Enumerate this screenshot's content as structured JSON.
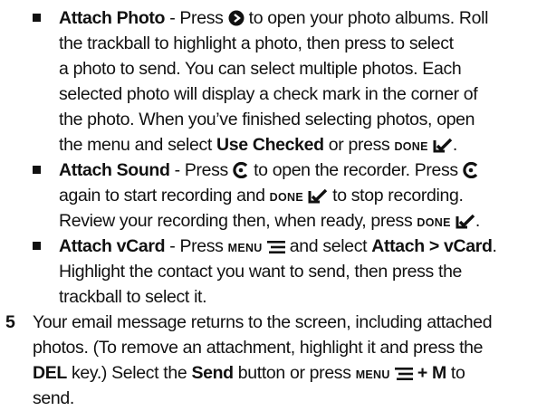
{
  "items": {
    "photo": {
      "title": "Attach Photo",
      "l1a": " - Press ",
      "l1b": " to open your photo albums. Roll",
      "l2": "the trackball to highlight a photo, then press to select",
      "l3": "a photo to send. You can select multiple photos. Each",
      "l4": "selected photo will display a check mark in the corner of",
      "l5": "the photo. When you’ve finished selecting photos, open",
      "l6a": "the menu and select ",
      "l6b": "Use Checked",
      "l6c": " or press ",
      "l6d": "DONE",
      "l6e": "."
    },
    "sound": {
      "title": "Attach Sound",
      "l1a": " - Press ",
      "l1b": " to open the recorder. Press ",
      "l2a": "again to start recording and ",
      "l2b": "DONE",
      "l2c": " to stop recording.",
      "l3a": "Review your recording then, when ready, press ",
      "l3b": "DONE",
      "l3c": "."
    },
    "vcard": {
      "title": "Attach vCard",
      "l1a": " - Press ",
      "l1b": "MENU",
      "l1c": " and select ",
      "l1d": "Attach > vCard",
      "l1e": ".",
      "l2": "Highlight the contact you want to send, then press the",
      "l3": "trackball to select it."
    }
  },
  "step5": {
    "number": "5",
    "l1": "Your email message returns to the screen, including attached",
    "l2": "photos. (To remove an attachment, highlight it and press the",
    "l3a": "DEL",
    "l3b": " key.) Select the ",
    "l3c": "Send",
    "l3d": " button or press ",
    "l3e": "MENU",
    "l3f": " + M",
    "l3g": " to",
    "l4": "send."
  },
  "icons": {
    "trackball": "trackball-icon",
    "record": "record-icon",
    "done": "done-check-icon",
    "menu": "menu-icon"
  },
  "colors": {
    "text": "#111111"
  }
}
